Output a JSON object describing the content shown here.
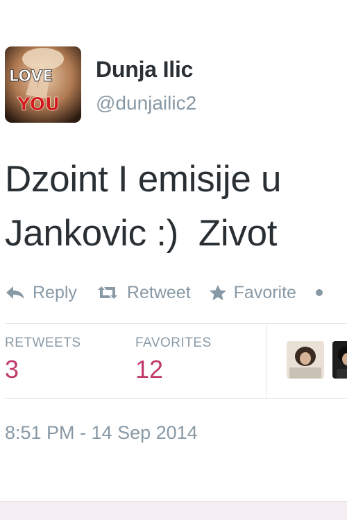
{
  "user": {
    "display_name": "Dunja Ilic",
    "screen_name": "@dunjailic2",
    "avatar_text": [
      "LOVE",
      "YOU"
    ]
  },
  "tweet": {
    "lines": [
      "Dzoint I emisije u",
      "Jankovic :)  Zivot"
    ]
  },
  "actions": {
    "reply_label": "Reply",
    "retweet_label": "Retweet",
    "favorite_label": "Favorite",
    "more_icon": "more-dot-icon"
  },
  "stats": {
    "retweets_label": "RETWEETS",
    "retweets_count": "3",
    "favorites_label": "FAVORITES",
    "favorites_count": "12"
  },
  "timestamp": "8:51 PM - 14 Sep 2014",
  "colors": {
    "text": "#292f33",
    "muted": "#8899a6",
    "count": "#c0386a",
    "divider": "#e1e8ed",
    "reply_bar": "#f5eef3"
  }
}
